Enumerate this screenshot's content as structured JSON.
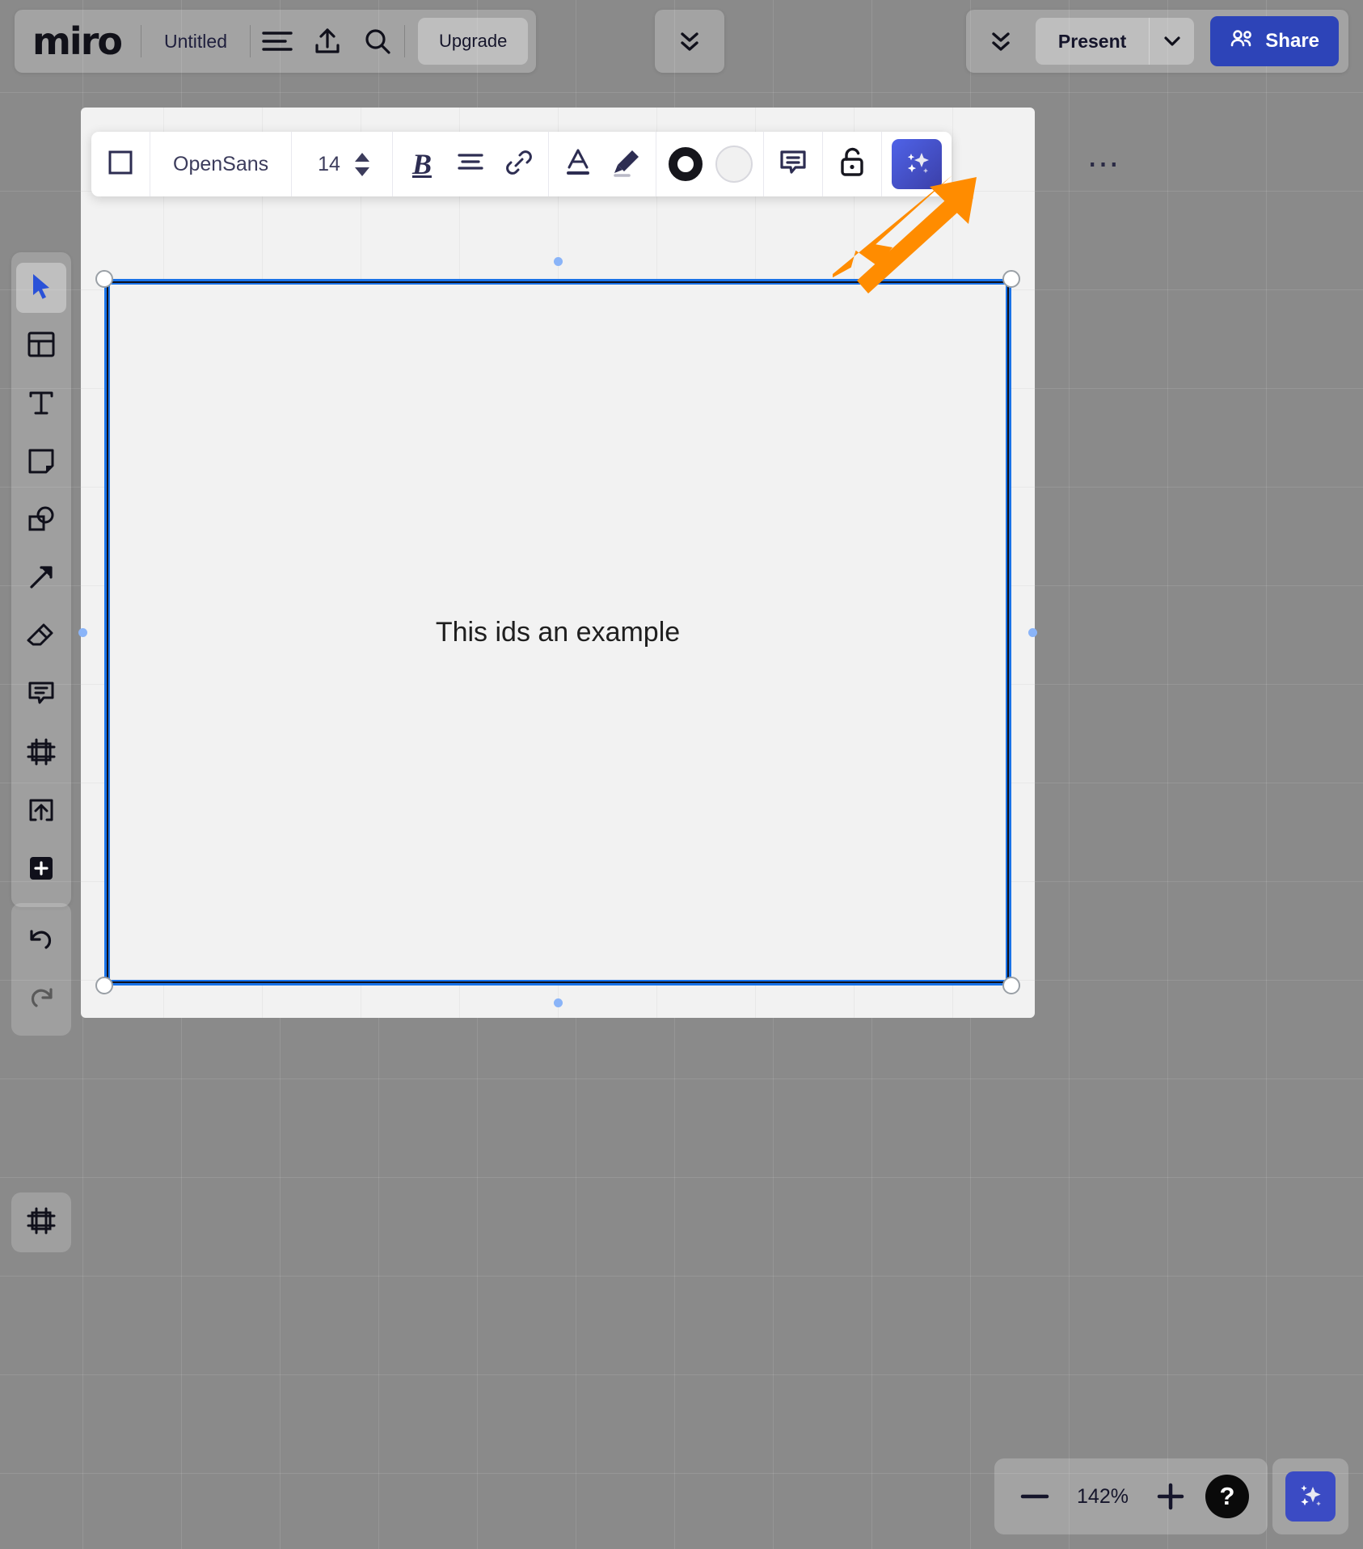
{
  "app": {
    "name": "miro",
    "document_title": "Untitled"
  },
  "topbar": {
    "logo_text": "miro",
    "title": "Untitled",
    "menu_icon": "hamburger-menu-icon",
    "export_icon": "upload-share-icon",
    "search_icon": "search-icon",
    "upgrade_label": "Upgrade",
    "collapse_icon": "double-chevron-down-icon",
    "collapse_icon_2": "double-chevron-down-icon",
    "present_label": "Present",
    "present_caret_icon": "chevron-down-icon",
    "share_label": "Share",
    "share_icon": "people-icon",
    "share_color": "#2d44b8"
  },
  "left_toolbar": {
    "items": [
      {
        "name": "select-tool",
        "icon": "cursor-arrow-icon",
        "active": true
      },
      {
        "name": "templates-tool",
        "icon": "templates-grid-icon",
        "active": false
      },
      {
        "name": "text-tool",
        "icon": "text-t-icon",
        "active": false
      },
      {
        "name": "sticky-note-tool",
        "icon": "sticky-note-icon",
        "active": false
      },
      {
        "name": "shapes-tool",
        "icon": "shapes-icon",
        "active": false
      },
      {
        "name": "connector-tool",
        "icon": "arrow-diagonal-icon",
        "active": false
      },
      {
        "name": "eraser-tool",
        "icon": "eraser-icon",
        "active": false
      },
      {
        "name": "comment-tool",
        "icon": "comment-bubble-icon",
        "active": false
      },
      {
        "name": "frame-tool",
        "icon": "frame-icon",
        "active": false
      },
      {
        "name": "upload-tool",
        "icon": "upload-box-icon",
        "active": false
      },
      {
        "name": "more-apps-tool",
        "icon": "plus-square-icon",
        "active": false
      }
    ],
    "history": [
      {
        "name": "undo-button",
        "icon": "undo-arrow-icon"
      },
      {
        "name": "redo-button",
        "icon": "redo-arrow-icon"
      }
    ],
    "minimap": {
      "name": "minimap-button",
      "icon": "minimap-icon"
    }
  },
  "format_toolbar": {
    "shape_picker_icon": "square-shape-icon",
    "font_family": "OpenSans",
    "font_size": "14",
    "size_stepper_up_icon": "triangle-up-icon",
    "size_stepper_down_icon": "triangle-down-icon",
    "bold_label": "B",
    "align_icon": "text-align-icon",
    "link_icon": "link-chain-icon",
    "text_color_icon": "text-color-a-icon",
    "highlight_icon": "highlighter-pen-icon",
    "border_color_icon": "border-color-ring-icon",
    "fill_color_icon": "fill-color-circle-icon",
    "comment_icon": "comment-bubble-icon",
    "lock_icon": "unlock-open-padlock-icon",
    "ai_icon": "ai-sparkles-icon",
    "more_label": "⋯"
  },
  "canvas": {
    "shape_text": "This ids an example",
    "selection_color": "#1a73e8",
    "shape_border_color": "#10101b",
    "shape_fill_color": "#f2f2f2"
  },
  "annotation": {
    "arrow_color": "#ff8c00",
    "points_to": "unlock-open-padlock-icon"
  },
  "zoom_bar": {
    "minus_label": "−",
    "zoom_level": "142%",
    "plus_label": "+",
    "help_label": "?",
    "ai_icon": "ai-sparkles-icon"
  }
}
